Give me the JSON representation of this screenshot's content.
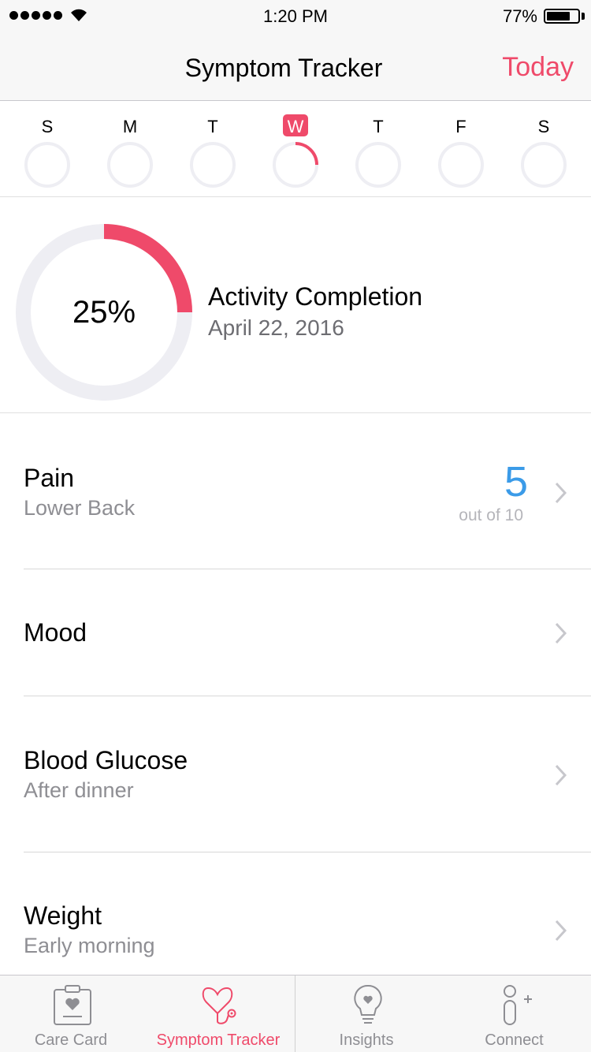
{
  "status_bar": {
    "time": "1:20 PM",
    "battery": "77%",
    "battery_level": 0.77
  },
  "nav": {
    "title": "Symptom Tracker",
    "today_button": "Today"
  },
  "week": {
    "days": [
      "S",
      "M",
      "T",
      "W",
      "T",
      "F",
      "S"
    ],
    "selected_index": 3,
    "progress": [
      0,
      0,
      0,
      0.25,
      0,
      0,
      0
    ]
  },
  "activity": {
    "percent_label": "25%",
    "progress": 0.25,
    "title": "Activity Completion",
    "date": "April 22, 2016"
  },
  "rows": [
    {
      "title": "Pain",
      "subtitle": "Lower Back",
      "value": "5",
      "scale": "out of 10"
    },
    {
      "title": "Mood"
    },
    {
      "title": "Blood Glucose",
      "subtitle": "After dinner"
    },
    {
      "title": "Weight",
      "subtitle": "Early morning"
    }
  ],
  "tabs": [
    {
      "label": "Care Card",
      "icon": "care-card-icon"
    },
    {
      "label": "Symptom Tracker",
      "icon": "stethoscope-icon"
    },
    {
      "label": "Insights",
      "icon": "lightbulb-icon"
    },
    {
      "label": "Connect",
      "icon": "add-contact-icon"
    }
  ],
  "colors": {
    "accent": "#ef4a6a",
    "value_blue": "#3b9be8",
    "ring_track": "#eeeef3"
  }
}
